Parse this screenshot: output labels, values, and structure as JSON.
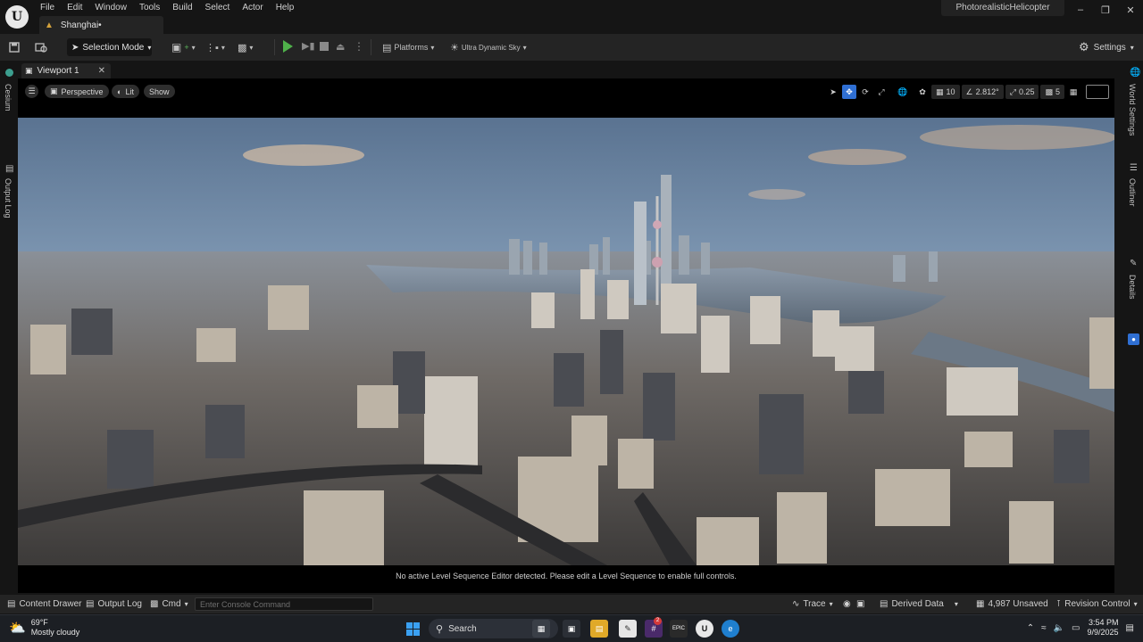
{
  "app": {
    "menu": [
      "File",
      "Edit",
      "Window",
      "Tools",
      "Build",
      "Select",
      "Actor",
      "Help"
    ],
    "level_tab": "Shanghai•",
    "project_name": "PhotorealisticHelicopter"
  },
  "toolbar": {
    "selection_mode": "Selection Mode",
    "platforms": "Platforms",
    "sky": "Ultra Dynamic Sky",
    "settings": "Settings"
  },
  "side_tabs": {
    "left": [
      "Cesium",
      "Output Log"
    ],
    "right": [
      "World Settings",
      "Outliner",
      "Details"
    ]
  },
  "viewport": {
    "tab_label": "Viewport 1",
    "view_mode": "Perspective",
    "lighting": "Lit",
    "show": "Show",
    "grid_snap": "10",
    "rotation_snap": "2.812°",
    "scale_snap": "0.25",
    "camera_speed": "5",
    "status_message": "No active Level Sequence Editor detected. Please edit a Level Sequence to enable full controls."
  },
  "bottom_bar": {
    "content_drawer": "Content Drawer",
    "output_log": "Output Log",
    "cmd": "Cmd",
    "console_placeholder": "Enter Console Command",
    "trace": "Trace",
    "derived_data": "Derived Data",
    "unsaved": "4,987 Unsaved",
    "revision_control": "Revision Control"
  },
  "taskbar": {
    "weather_temp": "69°F",
    "weather_desc": "Mostly cloudy",
    "search": "Search",
    "epic_badge": "2",
    "time": "3:54 PM",
    "date": "9/9/2025"
  },
  "colors": {
    "accent_blue": "#2f6fd3",
    "play_green": "#4fb04a",
    "level_tab_icon": "#d4a23c"
  }
}
